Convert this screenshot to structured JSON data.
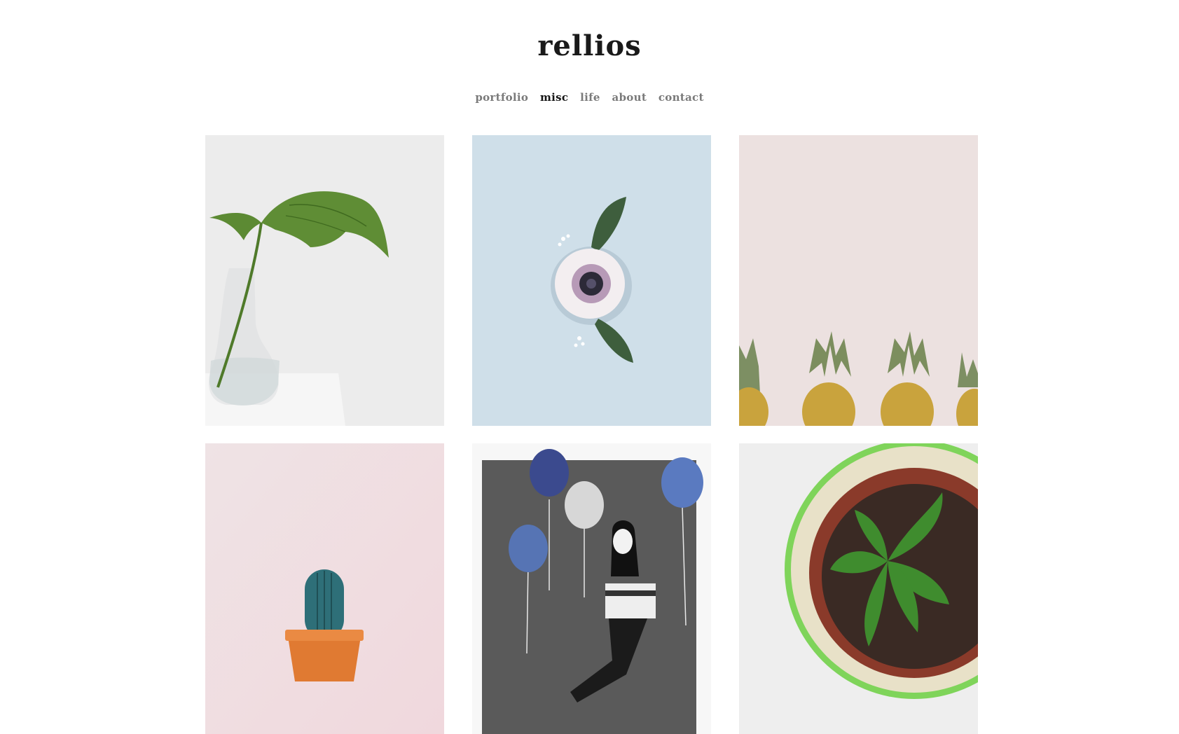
{
  "site": {
    "logo": "rellios"
  },
  "nav": {
    "items": [
      {
        "label": "portfolio",
        "active": false
      },
      {
        "label": "misc",
        "active": true
      },
      {
        "label": "life",
        "active": false
      },
      {
        "label": "about",
        "active": false
      },
      {
        "label": "contact",
        "active": false
      }
    ]
  },
  "gallery": {
    "items": [
      {
        "subject": "monstera-leaf-in-glass-vase",
        "background": "#ececec"
      },
      {
        "subject": "anemone-flower-on-blue",
        "background": "#cfdfe9"
      },
      {
        "subject": "pineapples-on-pink",
        "background": "#ece1e0"
      },
      {
        "subject": "cactus-in-orange-pot",
        "background": "#f1dde0"
      },
      {
        "subject": "girl-with-balloons-illustration",
        "background": "#f7f7f7"
      },
      {
        "subject": "pepper-plant-in-pot",
        "background": "#eeeeee"
      }
    ]
  },
  "colors": {
    "text_dark": "#1a1a1a",
    "nav_inactive": "#7a7a7a",
    "page_background": "#ffffff"
  }
}
